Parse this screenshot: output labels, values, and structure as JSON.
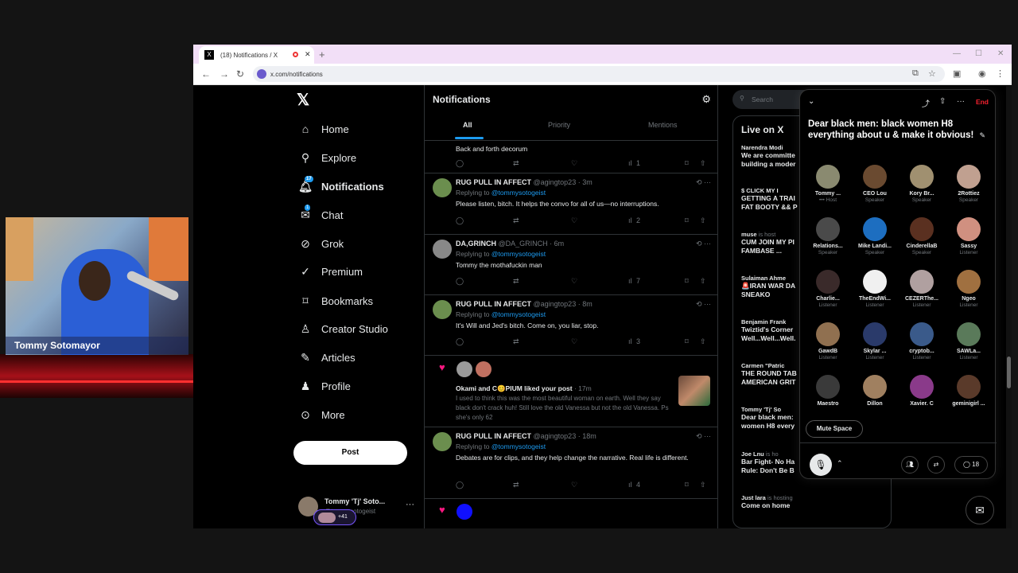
{
  "webcam": {
    "label": "Tommy Sotomayor"
  },
  "browser": {
    "tab_title": "(18) Notifications / X",
    "url": "x.com/notifications"
  },
  "sidebar": {
    "items": [
      {
        "label": "Home",
        "icon": "home-icon"
      },
      {
        "label": "Explore",
        "icon": "search-icon"
      },
      {
        "label": "Notifications",
        "icon": "bell-icon",
        "badge": "17"
      },
      {
        "label": "Chat",
        "icon": "mail-icon",
        "badge": "1"
      },
      {
        "label": "Grok",
        "icon": "grok-icon"
      },
      {
        "label": "Premium",
        "icon": "premium-icon"
      },
      {
        "label": "Bookmarks",
        "icon": "bookmark-icon"
      },
      {
        "label": "Creator Studio",
        "icon": "flask-icon"
      },
      {
        "label": "Articles",
        "icon": "article-icon"
      },
      {
        "label": "Profile",
        "icon": "person-icon"
      },
      {
        "label": "More",
        "icon": "more-circle-icon"
      }
    ],
    "post_label": "Post",
    "account": {
      "name": "Tommy 'Tj' Soto...",
      "handle": "@tommysotogeist"
    }
  },
  "feed": {
    "title": "Notifications",
    "tabs": [
      "All",
      "Priority",
      "Mentions"
    ],
    "top_snippet": "Back and forth decorum",
    "top_views": "1",
    "posts": [
      {
        "name": "RUG PULL IN AFFECT",
        "handle": "@agingtop23 · 3m",
        "replying": "Replying to",
        "to": "@tommysotogeist",
        "text": "Please listen, bitch. It helps the convo for all of us—no interruptions.",
        "views": "2"
      },
      {
        "name": "DA,GRINCH",
        "handle": "@DA_GRINCH · 6m",
        "replying": "Replying to",
        "to": "@tommysotogeist",
        "text": "Tommy the mothafuckin man",
        "views": "7"
      },
      {
        "name": "RUG PULL IN AFFECT",
        "handle": "@agingtop23 · 8m",
        "replying": "Replying to",
        "to": "@tommysotogeist",
        "text": "It's Will and Jed's bitch. Come on, you liar, stop.",
        "views": "3"
      },
      {
        "name": "RUG PULL IN AFFECT",
        "handle": "@agingtop23 · 18m",
        "replying": "Replying to",
        "to": "@tommysotogeist",
        "text": "Debates are for clips, and they help change the narrative. Real life is different.",
        "views": "4"
      }
    ],
    "like": {
      "who": "Okami and C😊PIUM liked your post",
      "time": "· 17m",
      "text": "I used to think this was the most beautiful woman on earth. Well they say black don't crack huh!  Still love the old Vanessa but not the old Vanessa.  Ps she's only 62"
    }
  },
  "right": {
    "search_placeholder": "Search",
    "live_title": "Live on X",
    "live": [
      {
        "host": "Narendra Modi",
        "suffix": "",
        "title": "We are committe",
        "title2": "building a moder"
      },
      {
        "host": "$ CLICK MY I",
        "suffix": "",
        "title": "GETTING A TRAI",
        "title2": "FAT BOOTY && P"
      },
      {
        "host": "muse",
        "suffix": " is host",
        "title": "CUM JOIN MY PI",
        "title2": "FAMBASE ..."
      },
      {
        "host": "Sulaiman Ahme",
        "suffix": "",
        "title": "🚨IRAN WAR DA",
        "title2": "SNEAKO"
      },
      {
        "host": "Benjamin Frank",
        "suffix": "",
        "title": "Twiztid's Corner",
        "title2": "Well...Well...Well."
      },
      {
        "host": "Carmen \"Patric",
        "suffix": "",
        "title": "THE ROUND TAB",
        "title2": "AMERICAN GRIT"
      },
      {
        "host": "Tommy 'Tj' So",
        "suffix": "",
        "title": "Dear black men:",
        "title2": "women H8 every"
      },
      {
        "host": "Joe Lnu",
        "suffix": " is ho",
        "title": "Bar Fight- No Ha",
        "title2": "Rule: Don't Be B"
      },
      {
        "host": "Just lara",
        "suffix": " is hosting",
        "title": "Come on home",
        "title2": ""
      }
    ],
    "plus": "+41"
  },
  "space": {
    "end_label": "End",
    "title": "Dear black men: black women H8 everything about u & make it obvious!",
    "speakers": [
      {
        "name": "Tommy ...",
        "role": "••• Host",
        "color": "#8a8a70"
      },
      {
        "name": "CEO Lou",
        "role": "Speaker",
        "color": "#6a4a30"
      },
      {
        "name": "Kory Br...",
        "role": "Speaker",
        "color": "#a09070"
      },
      {
        "name": "2Rottiez",
        "role": "Speaker",
        "color": "#c0a090"
      },
      {
        "name": "Relations...",
        "role": "Speaker",
        "color": "#4a4a4a"
      },
      {
        "name": "Mike Landi...",
        "role": "Speaker",
        "color": "#1d6ec0"
      },
      {
        "name": "CinderellaB",
        "role": "Speaker",
        "color": "#5a3020"
      },
      {
        "name": "Sassy",
        "role": "Listener",
        "color": "#d09080"
      },
      {
        "name": "Charlie...",
        "role": "Listener",
        "color": "#3a2a2a"
      },
      {
        "name": "TheEndWi...",
        "role": "Listener",
        "color": "#f0f0f0"
      },
      {
        "name": "CEZERThe...",
        "role": "Listener",
        "color": "#b0a0a0"
      },
      {
        "name": "Ngeo",
        "role": "Listener",
        "color": "#a07040"
      },
      {
        "name": "GawdB",
        "role": "Listener",
        "color": "#907050"
      },
      {
        "name": "Skylar ...",
        "role": "Listener",
        "color": "#2a3a6a"
      },
      {
        "name": "cryptob...",
        "role": "Listener",
        "color": "#3a5a8a"
      },
      {
        "name": "SAWLa...",
        "role": "Listener",
        "color": "#5a7a5a"
      },
      {
        "name": "Maestro",
        "role": "",
        "color": "#3a3a3a"
      },
      {
        "name": "Dillon",
        "role": "",
        "color": "#a08060"
      },
      {
        "name": "Xavier. C",
        "role": "",
        "color": "#8a3a8a"
      },
      {
        "name": "geminigirl ...",
        "role": "",
        "color": "#5a3a2a"
      }
    ],
    "mute_label": "Mute Space",
    "comments": "18"
  }
}
